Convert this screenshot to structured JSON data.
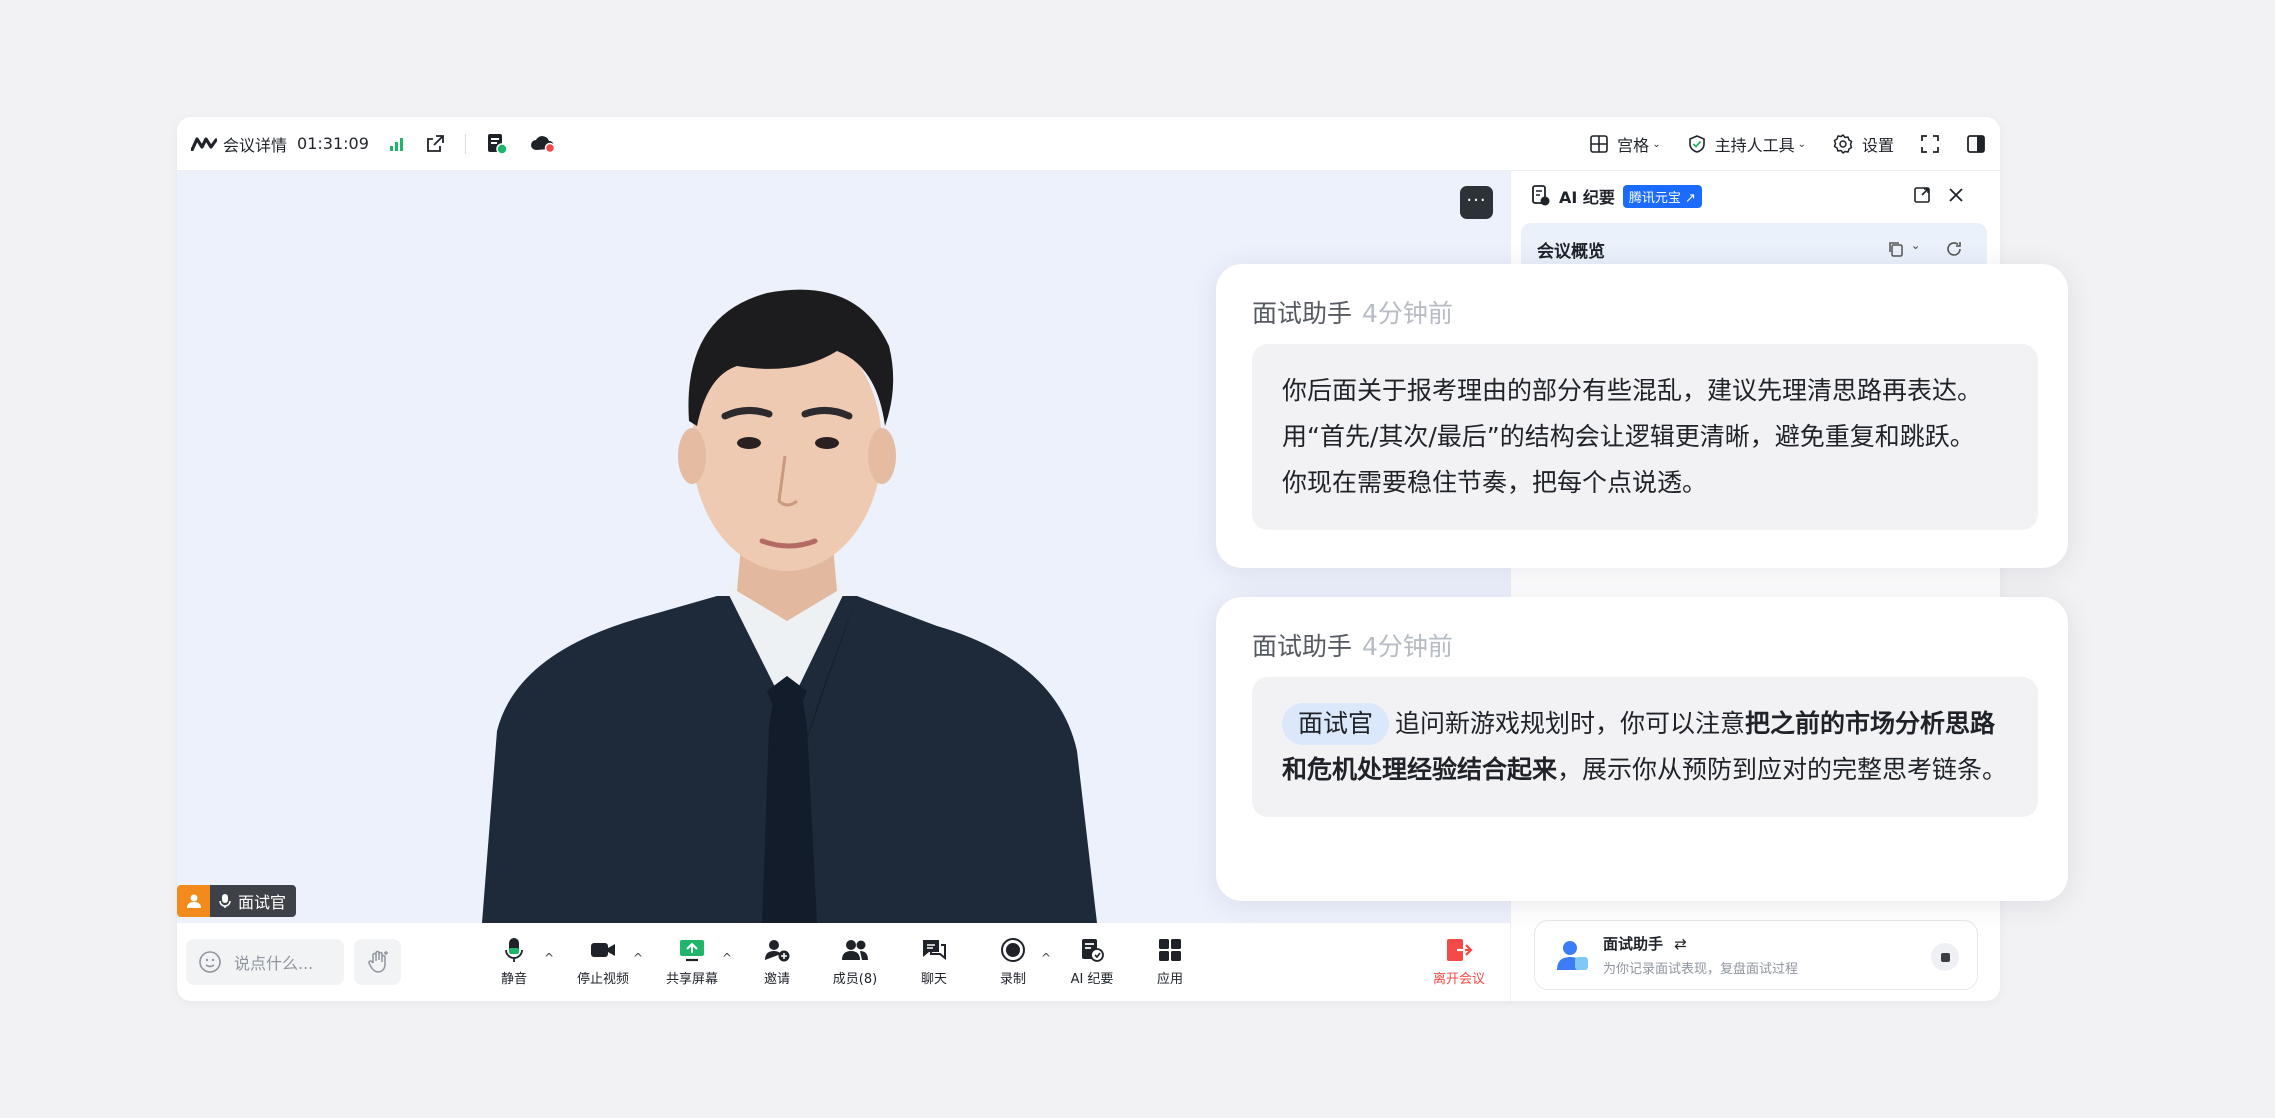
{
  "topbar": {
    "meeting_details": "会议详情",
    "duration": "01:31:09",
    "grid_label": "宫格",
    "host_tools_label": "主持人工具",
    "settings_label": "设置"
  },
  "stage": {
    "more_label": "···",
    "nametag_label": "面试官"
  },
  "bottombar": {
    "say_placeholder": "说点什么...",
    "tools": {
      "mute": "静音",
      "stop_video": "停止视频",
      "share_screen": "共享屏幕",
      "invite": "邀请",
      "members": "成员(8)",
      "chat": "聊天",
      "record": "录制",
      "ai_minutes": "AI 纪要",
      "apps": "应用",
      "leave": "离开会议"
    }
  },
  "side_panel": {
    "title": "AI 纪要",
    "tag": "腾讯元宝 ↗",
    "overview_title": "会议概览",
    "assistant": {
      "name": "面试助手",
      "switch_icon": "⇄",
      "description": "为你记录面试表现，复盘面试过程"
    }
  },
  "cards": [
    {
      "sender": "面试助手",
      "time": "4分钟前",
      "lines": [
        "你后面关于报考理由的部分有些混乱，建议先理清思路再表达。",
        "用“首先/其次/最后”的结构会让逻辑更清晰，避免重复和跳跃。",
        "你现在需要稳住节奏，把每个点说透。"
      ]
    },
    {
      "sender": "面试助手",
      "time": "4分钟前",
      "mention": "面试官",
      "text_before": "追问新游戏规划时，你可以注意",
      "text_bold": "把之前的市场分析思路和危机处理经验结合起来",
      "text_after": "，展示你从预防到应对的完整思考链条。"
    }
  ],
  "colors": {
    "accent_blue": "#1b6bff",
    "signal_green": "#1fb56b",
    "leave_red": "#f54a45",
    "nametag_orange": "#f28a1c"
  }
}
